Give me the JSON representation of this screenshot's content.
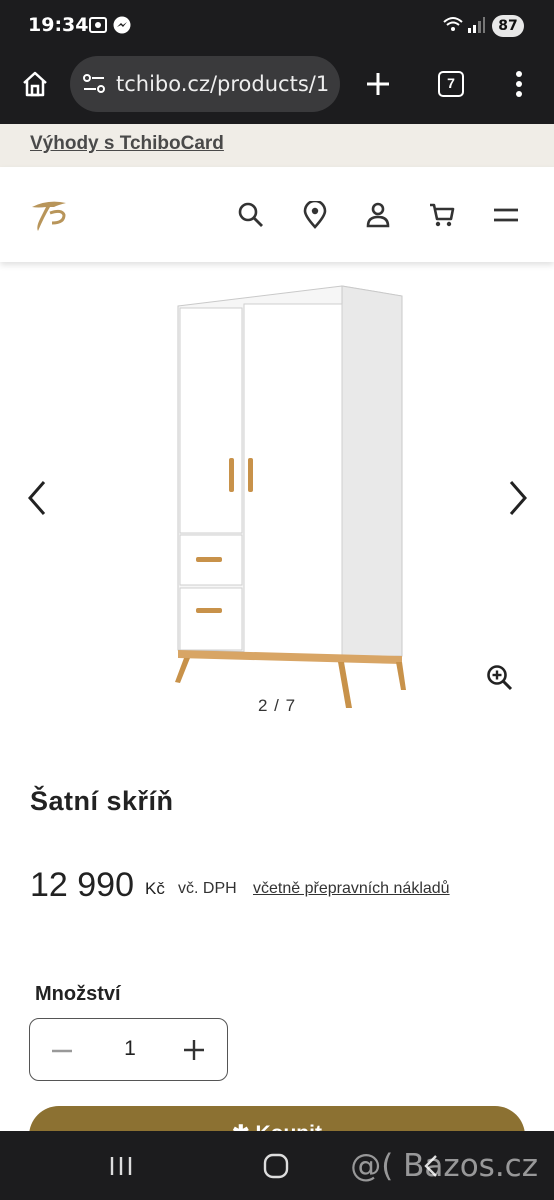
{
  "status_bar": {
    "time": "19:34",
    "battery": "87"
  },
  "browser": {
    "url": "tchibo.cz/products/1",
    "tab_count": "7"
  },
  "promo": {
    "link": "Výhody s TchiboCard"
  },
  "gallery": {
    "counter": "2 / 7"
  },
  "product": {
    "title": "Šatní skříň",
    "price": "12 990",
    "currency": "Kč",
    "vat": "vč. DPH",
    "shipping_link": "včetně přepravních nákladů"
  },
  "quantity": {
    "label": "Množství",
    "value": "1"
  },
  "buy_button": {
    "label": "Koupit"
  },
  "watermark": "@( Bazos.cz",
  "colors": {
    "accent": "#8c7132",
    "logo": "#b8955a",
    "system_bar": "#1c1c1e"
  }
}
